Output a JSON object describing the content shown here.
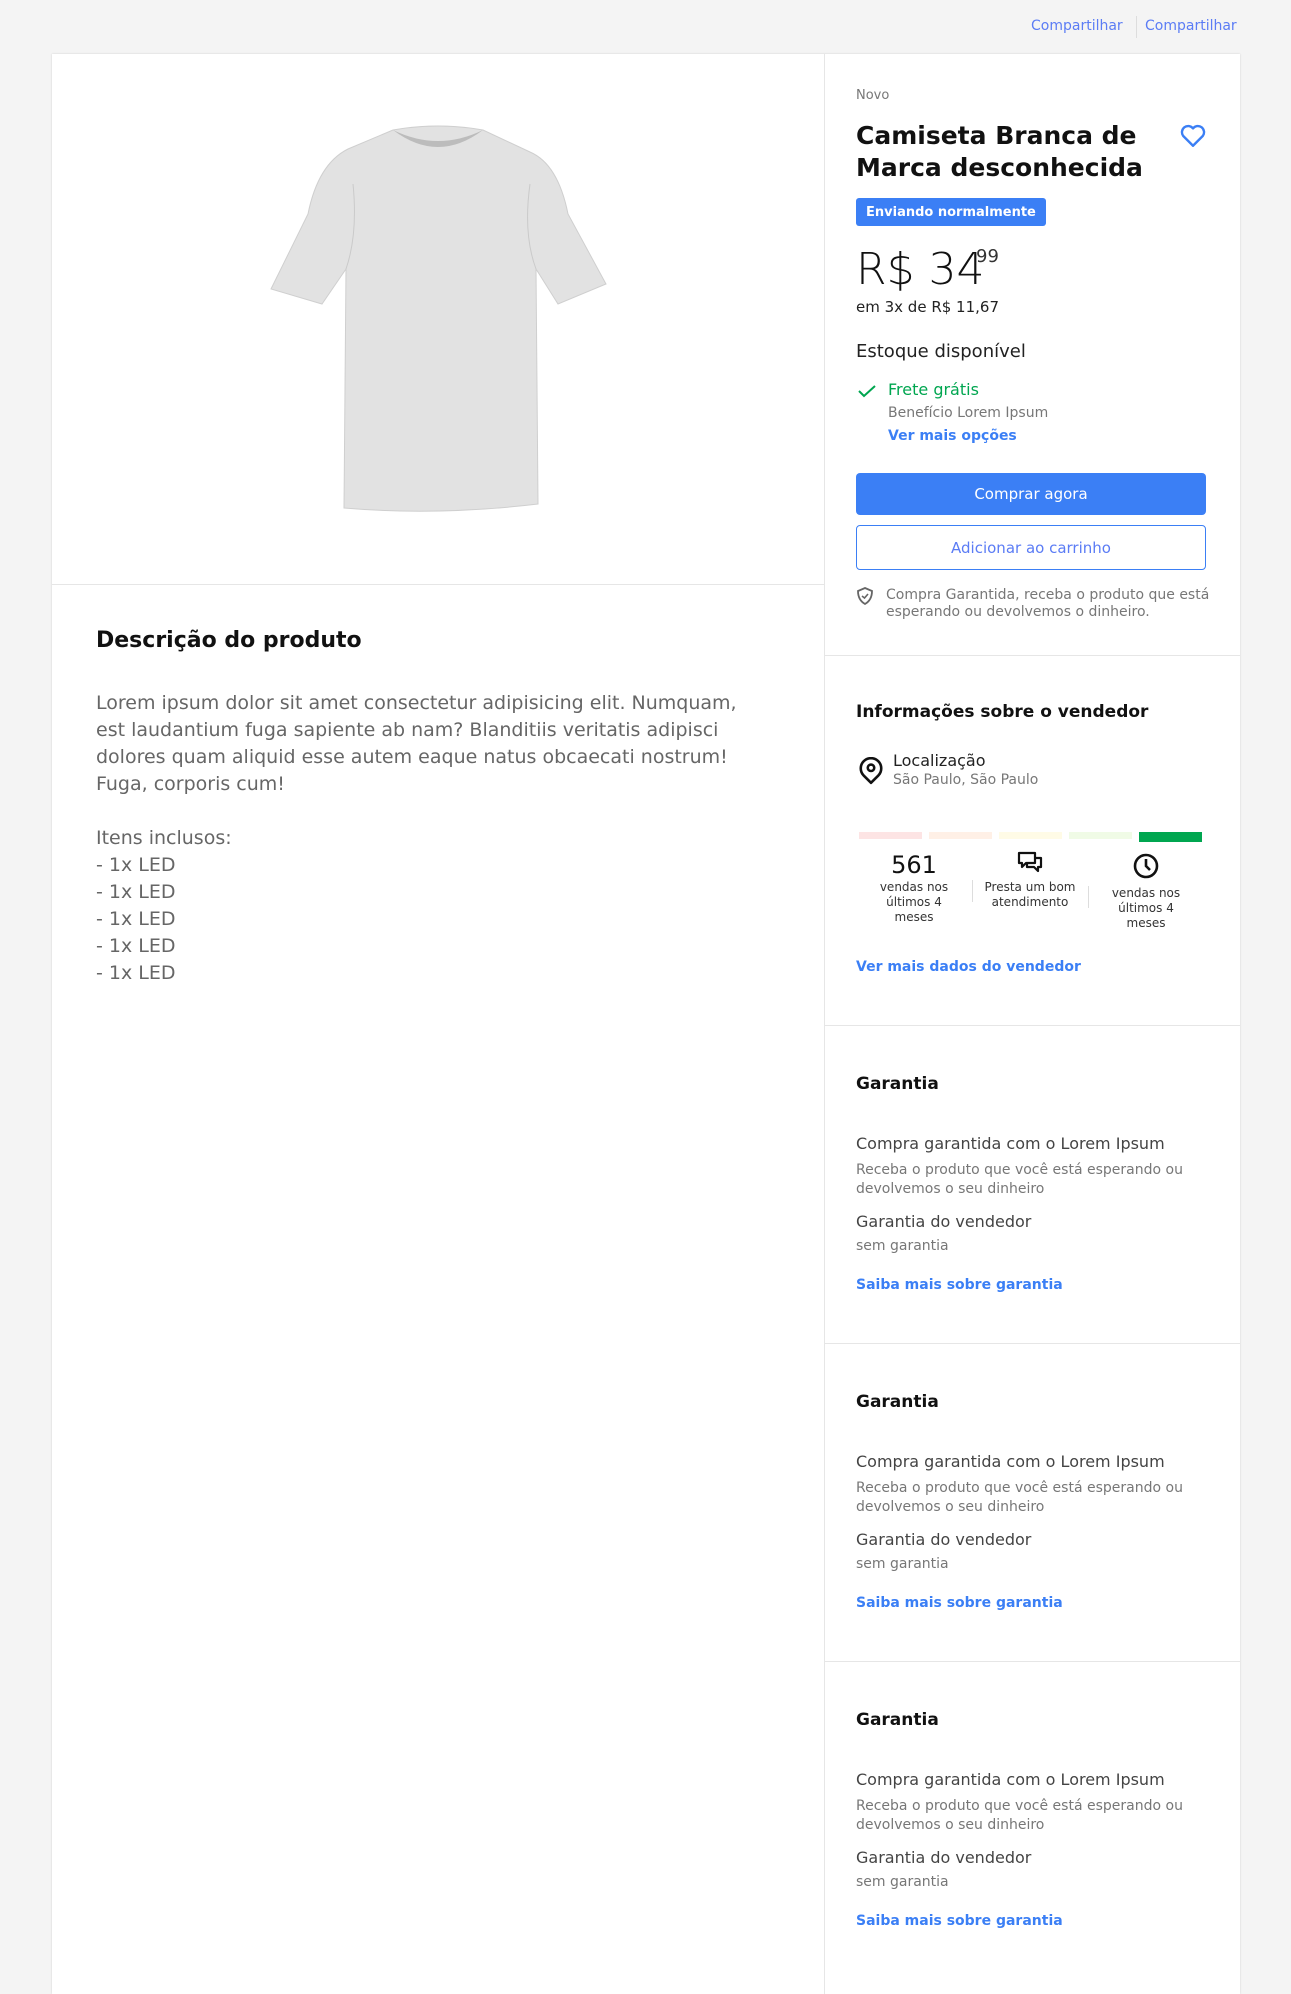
{
  "header": {
    "share_links": [
      "Compartilhar",
      "Compartilhar"
    ]
  },
  "product": {
    "condition": "Novo",
    "title_line1": "Camiseta Branca de",
    "title_line2": "Marca desconhecida",
    "badge": "Enviando normalmente",
    "price_main": "R$ 34",
    "price_cents": "99",
    "installments": "em 3x de R$ 11,67",
    "stock": "Estoque disponível",
    "shipping_title": "Frete grátis",
    "shipping_benefit": "Benefício Lorem Ipsum",
    "shipping_link": "Ver mais opções",
    "buy_now": "Comprar agora",
    "add_to_cart": "Adicionar ao carrinho",
    "guarantee_line1": "Compra Garantida, receba o produto que está",
    "guarantee_line2": "esperando ou devolvemos o dinheiro.",
    "accent_color": "#3b7ff5"
  },
  "description": {
    "title": "Descrição do produto",
    "paragraph": [
      "Lorem ipsum dolor sit amet consectetur adipisicing elit. Numquam,",
      "est laudantium fuga sapiente ab nam? Blanditiis veritatis adipisci",
      "dolores quam aliquid esse autem eaque natus obcaecati nostrum!",
      "Fuga, corporis cum!"
    ],
    "items_title": "Itens inclusos:",
    "items": [
      "- 1x LED",
      "- 1x LED",
      "- 1x LED",
      "- 1x LED",
      "- 1x LED"
    ]
  },
  "seller": {
    "title": "Informações sobre o vendedor",
    "location_label": "Localização",
    "location_value": "São Paulo, São Paulo",
    "reputation_level": 5,
    "reputation_colors": [
      "#fde4e4",
      "#fff0e6",
      "#fffbe6",
      "#f0fbe6",
      "#00a650"
    ],
    "sales_count": "561",
    "sales_label": [
      "vendas nos",
      "últimos 4",
      "meses"
    ],
    "service_label": [
      "Presta um bom",
      "atendimento"
    ],
    "time_label": [
      "vendas nos",
      "últimos 4",
      "meses"
    ],
    "link": "Ver mais dados do vendedor"
  },
  "warranty_sections": [
    {
      "title": "Garantia",
      "guaranteed": "Compra garantida com o Lorem Ipsum",
      "desc1": "Receba o produto que você está esperando ou",
      "desc2": "devolvemos o seu dinheiro",
      "seller_title": "Garantia do vendedor",
      "seller_value": "sem garantia",
      "link": "Saiba mais sobre garantia"
    },
    {
      "title": "Garantia",
      "guaranteed": "Compra garantida com o Lorem Ipsum",
      "desc1": "Receba o produto que você está esperando ou",
      "desc2": "devolvemos o seu dinheiro",
      "seller_title": "Garantia do vendedor",
      "seller_value": "sem garantia",
      "link": "Saiba mais sobre garantia"
    },
    {
      "title": "Garantia",
      "guaranteed": "Compra garantida com o Lorem Ipsum",
      "desc1": "Receba o produto que você está esperando ou",
      "desc2": "devolvemos o seu dinheiro",
      "seller_title": "Garantia do vendedor",
      "seller_value": "sem garantia",
      "link": "Saiba mais sobre garantia"
    }
  ]
}
